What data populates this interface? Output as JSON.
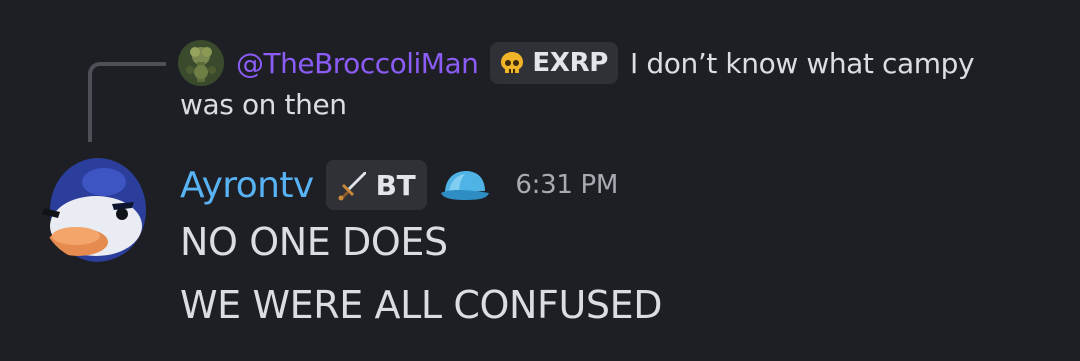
{
  "reply": {
    "author": "@TheBroccoliMan",
    "tag_label": "EXRP",
    "tag_icon": "skull-icon",
    "text_line1": "I don’t know what campy",
    "text_line2": "was on then",
    "author_color": "#8b5cf6"
  },
  "message": {
    "username": "Ayrontv",
    "username_color": "#58b3f4",
    "tag_label": "BT",
    "tag_icon": "sword-icon",
    "badge_icon": "helmet-icon",
    "timestamp": "6:31 PM",
    "lines": [
      "NO ONE DOES",
      "WE WERE ALL CONFUSED"
    ]
  },
  "colors": {
    "background": "#1e1f24",
    "tag_background": "#2f3136",
    "text": "#dbdee1",
    "timestamp": "#a7abb2"
  }
}
